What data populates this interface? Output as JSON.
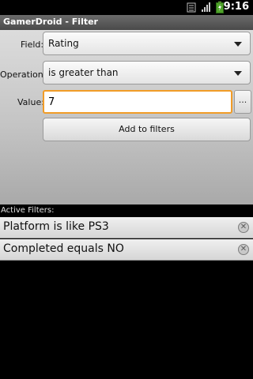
{
  "status_bar": {
    "time": "9:16",
    "icons": [
      "usb-debug-icon",
      "signal-icon",
      "battery-icon"
    ]
  },
  "app": {
    "title": "GamerDroid - Filter"
  },
  "form": {
    "field_label": "Field:",
    "field_value": "Rating",
    "operation_label": "Operation:",
    "operation_value": "is greater than",
    "value_label": "Value:",
    "value_input": "7",
    "picker_button_label": "...",
    "add_button_label": "Add to filters"
  },
  "active_filters": {
    "header": "Active Filters:",
    "items": [
      {
        "label": "Platform is like PS3"
      },
      {
        "label": "Completed equals NO"
      }
    ]
  },
  "colors": {
    "focus_border": "#f19c27",
    "background": "#000000"
  }
}
